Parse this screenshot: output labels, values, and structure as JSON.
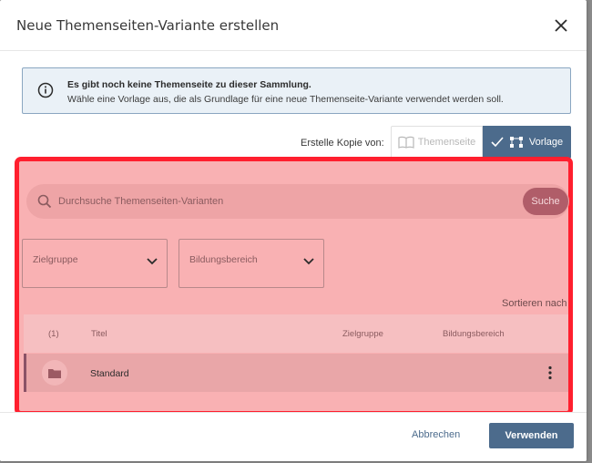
{
  "dialog": {
    "title": "Neue Themenseiten-Variante erstellen"
  },
  "info": {
    "line1": "Es gibt noch keine Themenseite zu dieser Sammlung.",
    "line2": "Wähle eine Vorlage aus, die als Grundlage für eine neue Themenseite-Variante verwendet werden soll."
  },
  "copy_from": {
    "label": "Erstelle Kopie von:",
    "option_themenseite": "Themenseite",
    "option_vorlage": "Vorlage",
    "selected": "Vorlage"
  },
  "search": {
    "placeholder": "Durchsuche Themenseiten-Varianten",
    "button": "Suche"
  },
  "filters": [
    {
      "label": "Zielgruppe"
    },
    {
      "label": "Bildungsbereich"
    }
  ],
  "sort_label": "Sortieren nach",
  "table": {
    "count": "(1)",
    "columns": [
      "Titel",
      "Zielgruppe",
      "Bildungsbereich"
    ],
    "rows": [
      {
        "title": "Standard",
        "zielgruppe": "",
        "bildungsbereich": ""
      }
    ]
  },
  "footer": {
    "cancel": "Abbrechen",
    "apply": "Verwenden"
  },
  "colors": {
    "primary": "#4c6b8c",
    "overlay_border": "#ff1f2e",
    "overlay_fill": "#f9b1b3"
  }
}
